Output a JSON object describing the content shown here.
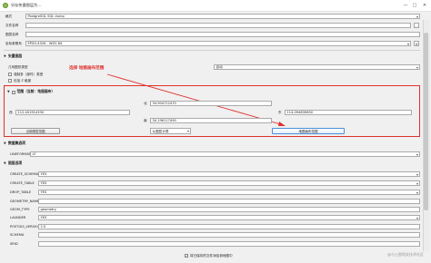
{
  "window": {
    "title": "另存矢量图层为...",
    "minimize_glyph": "—",
    "maximize_glyph": "□",
    "close_glyph": "✕"
  },
  "form": {
    "format_label": "格式",
    "format_value": "PostgreSQL SQL dump",
    "filename_label": "文件名称",
    "filename_value": "",
    "layername_label": "图层名称",
    "layername_value": "",
    "crs_label": "坐标参照系",
    "crs_value": "EPSG:4326 - WGS 84"
  },
  "encoding": {
    "title": "矢量图层",
    "geometry_type_label": "几何图形类型",
    "geometry_type_value": "自动",
    "force_multi_label": "强制多（部件）类型",
    "include_z_label": "包括 Z 维度"
  },
  "annotation": {
    "text": "选择 地图画布范围"
  },
  "extent": {
    "title": "范围（当前：地图画布）",
    "north_label": "北",
    "north_value": "34.904712470",
    "west_label": "西",
    "west_value": "112.401914330",
    "east_label": "东",
    "east_value": "114.094839650",
    "south_label": "南",
    "south_value": "34.196117490",
    "current_layer_button": "当前图层范围",
    "compute_from_layer": "从图层计算",
    "map_canvas_button": "地图画布范围"
  },
  "dataset_options": {
    "title": "数据集选项",
    "rows": [
      {
        "key": "LINEFORMAT",
        "value": "LF"
      }
    ]
  },
  "layer_options": {
    "title": "图层选项",
    "rows": [
      {
        "key": "CREATE_SCHEMA",
        "value": "YES"
      },
      {
        "key": "CREATE_TABLE",
        "value": "YES"
      },
      {
        "key": "DROP_TABLE",
        "value": "YES"
      },
      {
        "key": "GEOMETRY_NAME",
        "value": ""
      },
      {
        "key": "GEOM_TYPE",
        "value": "geometry"
      },
      {
        "key": "LAUNDER",
        "value": "YES"
      },
      {
        "key": "POSTGIS_VERSION",
        "value": "2.0"
      },
      {
        "key": "SCHEMA",
        "value": ""
      },
      {
        "key": "SRID",
        "value": ""
      }
    ]
  },
  "footer": {
    "add_to_map_label": "将已保存的文件添加到地图中"
  },
  "watermark": "@与土图相关技术社区",
  "colors": {
    "annotation_red": "#e0302d",
    "highlight_blue": "#4a90d9"
  }
}
